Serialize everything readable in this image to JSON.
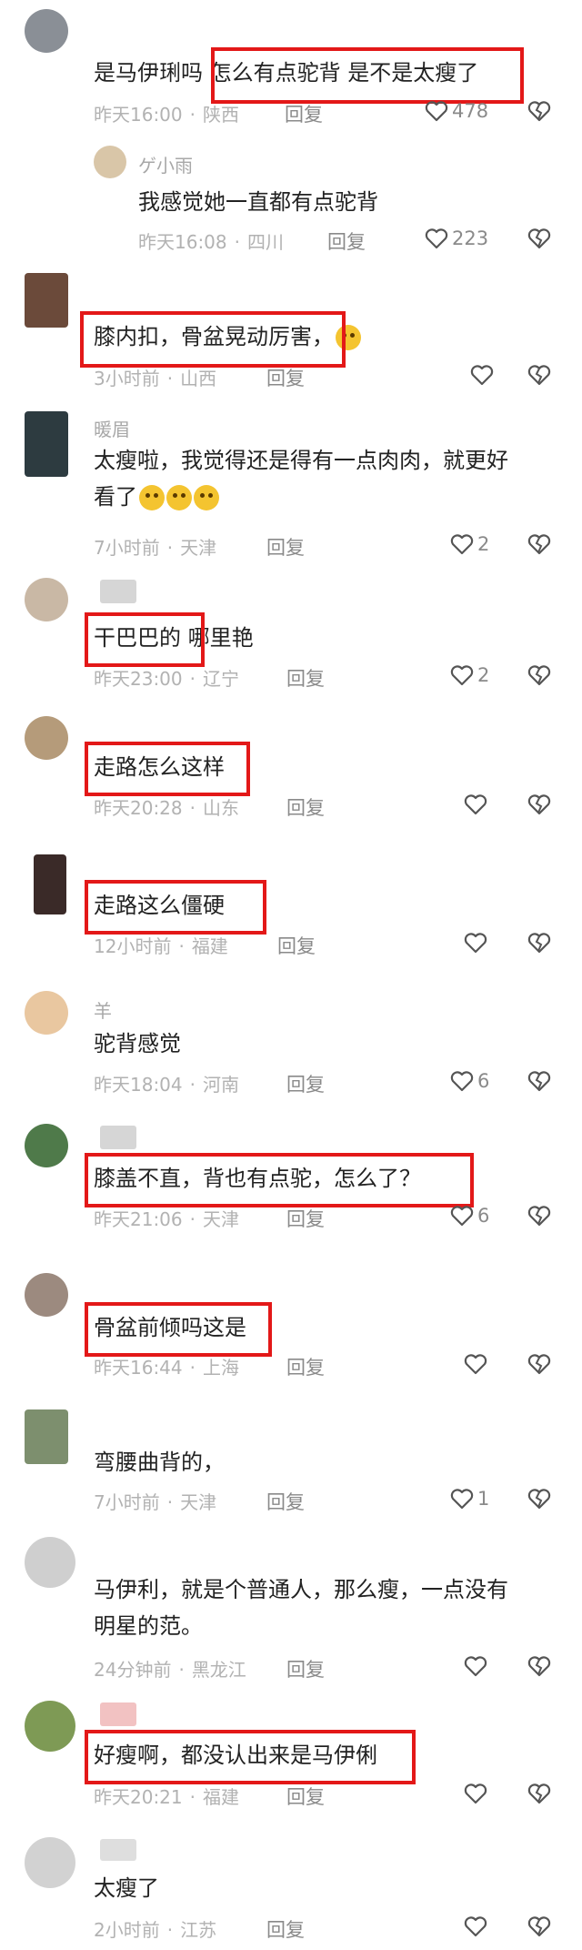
{
  "comments": [
    {
      "name": "",
      "text": "是马伊琍吗 怎么有点驼背 是不是太瘦了",
      "time": "昨天16:00",
      "location": "陕西",
      "reply": "回复",
      "likes": "478"
    },
    {
      "name": "ゲ小雨",
      "text": "我感觉她一直都有点驼背",
      "time": "昨天16:08",
      "location": "四川",
      "reply": "回复",
      "likes": "223"
    },
    {
      "name": "",
      "text": "膝内扣，骨盆晃动厉害，",
      "time": "3小时前",
      "location": "山西",
      "reply": "回复",
      "likes": ""
    },
    {
      "name": "暖眉",
      "text1": "太瘦啦，我觉得还是得有一点肉肉，就更好",
      "text2": "看了",
      "time": "7小时前",
      "location": "天津",
      "reply": "回复",
      "likes": "2"
    },
    {
      "name": "",
      "text": "干巴巴的 哪里艳",
      "time": "昨天23:00",
      "location": "辽宁",
      "reply": "回复",
      "likes": "2"
    },
    {
      "name": "",
      "text": "走路怎么这样",
      "time": "昨天20:28",
      "location": "山东",
      "reply": "回复",
      "likes": ""
    },
    {
      "name": "",
      "text": "走路这么僵硬",
      "time": "12小时前",
      "location": "福建",
      "reply": "回复",
      "likes": ""
    },
    {
      "name": "羊",
      "text": "驼背感觉",
      "time": "昨天18:04",
      "location": "河南",
      "reply": "回复",
      "likes": "6"
    },
    {
      "name": "",
      "text": "膝盖不直，背也有点驼，怎么了？",
      "time": "昨天21:06",
      "location": "天津",
      "reply": "回复",
      "likes": "6"
    },
    {
      "name": "",
      "text": "骨盆前倾吗这是",
      "time": "昨天16:44",
      "location": "上海",
      "reply": "回复",
      "likes": ""
    },
    {
      "name": "",
      "text": "弯腰曲背的，",
      "time": "7小时前",
      "location": "天津",
      "reply": "回复",
      "likes": "1"
    },
    {
      "name": "",
      "text1": "马伊利，就是个普通人，那么瘦，一点没有",
      "text2": "明星的范。",
      "time": "24分钟前",
      "location": "黑龙江",
      "reply": "回复",
      "likes": ""
    },
    {
      "name": "",
      "text": "好瘦啊，都没认出来是马伊俐",
      "time": "昨天20:21",
      "location": "福建",
      "reply": "回复",
      "likes": ""
    },
    {
      "name": "",
      "text": "太瘦了",
      "time": "2小时前",
      "location": "江苏",
      "reply": "回复",
      "likes": ""
    }
  ],
  "colors": {
    "highlight": "#e31818",
    "meta": "#b2b2b2",
    "text": "#222222"
  },
  "icons": {
    "like": "heart-outline-icon",
    "dislike": "broken-heart-icon",
    "emoji": "grinning-emoji-icon"
  }
}
